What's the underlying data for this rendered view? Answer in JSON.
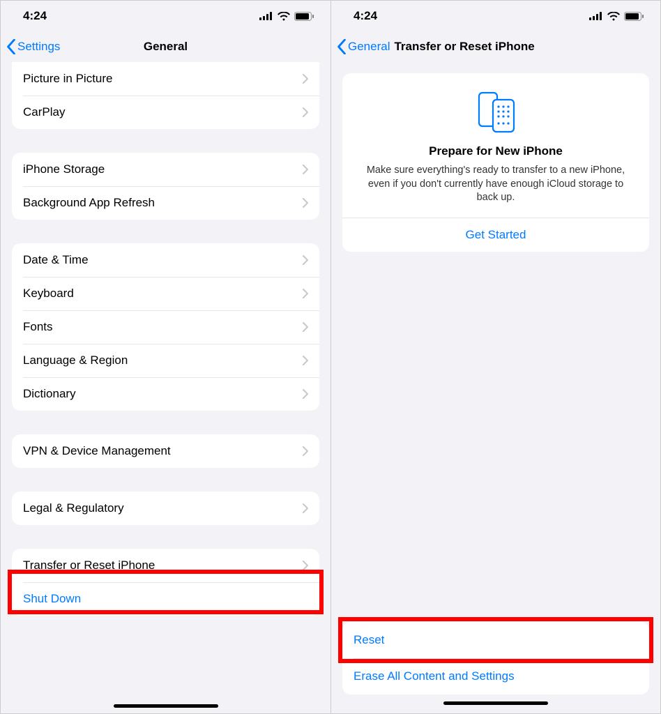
{
  "status": {
    "time": "4:24"
  },
  "left": {
    "back_label": "Settings",
    "title": "General",
    "group0": {
      "picture_in_picture": "Picture in Picture",
      "carplay": "CarPlay"
    },
    "group1": {
      "iphone_storage": "iPhone Storage",
      "background_refresh": "Background App Refresh"
    },
    "group2": {
      "date_time": "Date & Time",
      "keyboard": "Keyboard",
      "fonts": "Fonts",
      "language_region": "Language & Region",
      "dictionary": "Dictionary"
    },
    "group3": {
      "vpn": "VPN & Device Management"
    },
    "group4": {
      "legal": "Legal & Regulatory"
    },
    "group5": {
      "transfer_reset": "Transfer or Reset iPhone",
      "shut_down": "Shut Down"
    }
  },
  "right": {
    "back_label": "General",
    "title": "Transfer or Reset iPhone",
    "card": {
      "title": "Prepare for New iPhone",
      "sub": "Make sure everything's ready to transfer to a new iPhone, even if you don't currently have enough iCloud storage to back up.",
      "action": "Get Started"
    },
    "bottom": {
      "reset": "Reset",
      "erase": "Erase All Content and Settings"
    }
  }
}
